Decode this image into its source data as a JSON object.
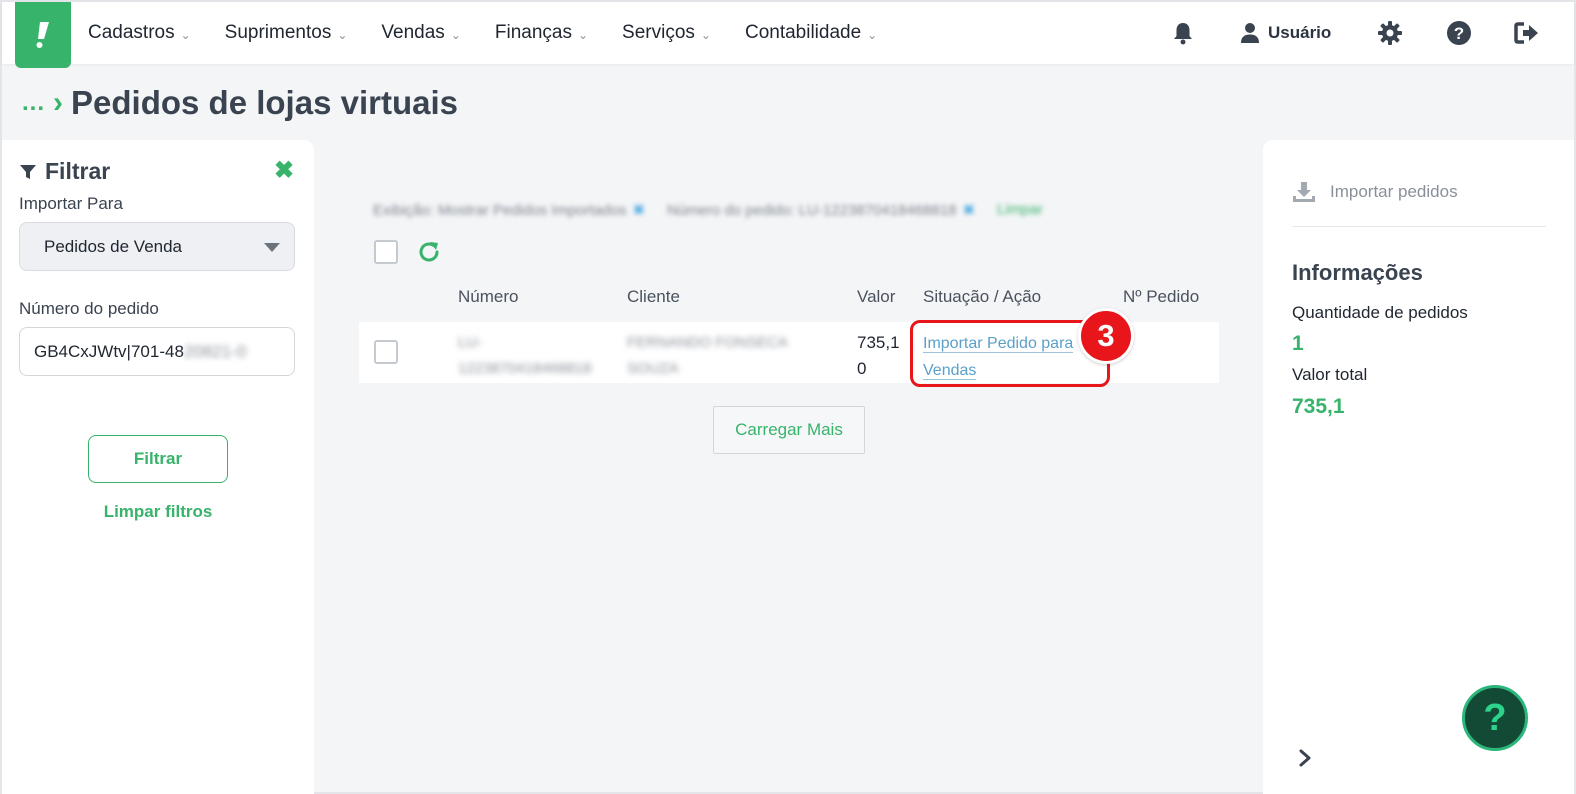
{
  "nav": {
    "items": [
      {
        "label": "Cadastros"
      },
      {
        "label": "Suprimentos"
      },
      {
        "label": "Vendas"
      },
      {
        "label": "Finanças"
      },
      {
        "label": "Serviços"
      },
      {
        "label": "Contabilidade"
      }
    ],
    "user_label": "Usuário",
    "icons": [
      "bell-icon",
      "user-icon",
      "gear-icon",
      "help-icon",
      "logout-icon"
    ]
  },
  "breadcrumb": {
    "ellipsis": "...",
    "title": "Pedidos de lojas virtuais"
  },
  "filter": {
    "title": "Filtrar",
    "import_to_label": "Importar Para",
    "import_to_value": "Pedidos de Venda",
    "order_number_label": "Número do pedido",
    "order_number_value": "GB4CxJWtv|701-48",
    "order_number_value_blurred": "20821-0",
    "filter_button": "Filtrar",
    "clear_link": "Limpar filtros"
  },
  "active_filters": {
    "display": "Exibição: Mostrar Pedidos Importados",
    "order": "Número do pedido: LU-1223870418468818",
    "clear": "Limpar"
  },
  "table": {
    "headers": [
      "Número",
      "Cliente",
      "Valor",
      "Situação / Ação",
      "Nº Pedido"
    ],
    "rows": [
      {
        "numero": "LU-1223870418468818",
        "cliente": "FERNANDO FONSECA SOUZA",
        "valor_line1": "735,1",
        "valor_line2": "0",
        "action_line1": "Importar Pedido para",
        "action_line2": "Vendas",
        "pedido": ""
      }
    ],
    "load_more": "Carregar Mais"
  },
  "annotation": {
    "step": "3",
    "color": "#e8151b"
  },
  "info": {
    "import_link": "Importar pedidos",
    "title": "Informações",
    "qty_label": "Quantidade de pedidos",
    "qty_value": "1",
    "total_label": "Valor total",
    "total_value": "735,1"
  },
  "colors": {
    "accent": "#38b36b",
    "link": "#5ba0c8",
    "text": "#3a4350"
  }
}
